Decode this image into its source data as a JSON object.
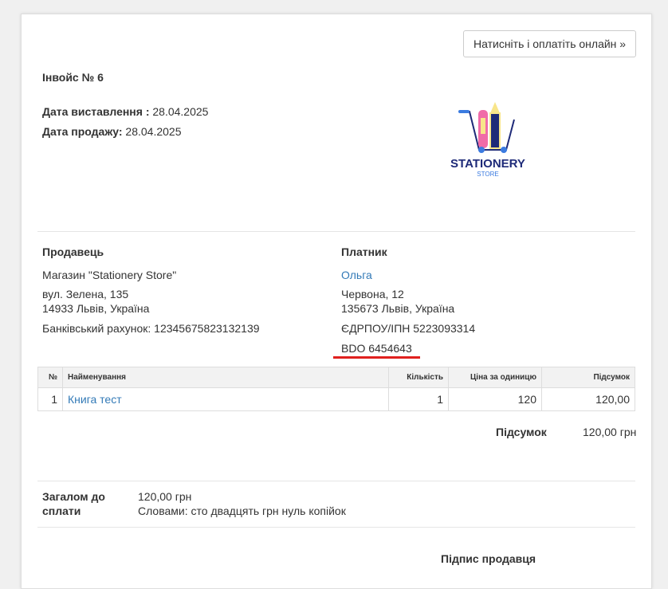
{
  "pay_button": "Натисніть і оплатіть онлайн »",
  "invoice_title": "Інвойс № 6",
  "issue_date_label": "Дата виставлення :",
  "issue_date": "28.04.2025",
  "sale_date_label": "Дата продажу:",
  "sale_date": "28.04.2025",
  "logo": {
    "name": "STATIONERY",
    "sub": "STORE"
  },
  "seller": {
    "heading": "Продавець",
    "name": "Магазин \"Stationery Store\"",
    "street": "вул. Зелена, 135",
    "city": "14933 Львів, Україна",
    "bank": "Банківський рахунок: 12345675823132139"
  },
  "payer": {
    "heading": "Платник",
    "name": "Ольга",
    "street": "Червона, 12",
    "city": "135673 Львів, Україна",
    "edrpou": "ЄДРПОУ/ІПН 5223093314",
    "bdo": "BDO 6454643"
  },
  "table": {
    "headers": [
      "№",
      "Найменування",
      "Кількість",
      "Ціна за одиницю",
      "Підсумок"
    ],
    "rows": [
      {
        "no": "1",
        "name": "Книга тест",
        "qty": "1",
        "price": "120",
        "total": "120,00"
      }
    ]
  },
  "subtotal_label": "Підсумок",
  "subtotal": "120,00 грн",
  "total_label": "Загалом до сплати",
  "total": "120,00 грн",
  "words": "Словами: сто двадцять грн нуль копійок",
  "signature_label": "Підпис продавця",
  "colors": {
    "link": "#337ab7",
    "underline": "#e0201e"
  }
}
